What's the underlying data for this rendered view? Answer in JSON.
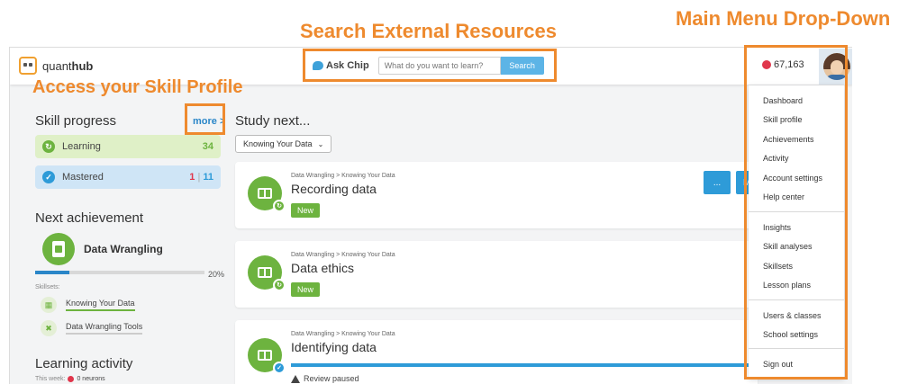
{
  "annotations": {
    "search_label": "Search External Resources",
    "menu_label": "Main Menu Drop-Down",
    "profile_label": "Access your Skill Profile"
  },
  "header": {
    "logo_prefix": "quant",
    "logo_bold": "hub",
    "ask_chip": "Ask Chip",
    "search_placeholder": "What do you want to learn?",
    "search_button": "Search",
    "neurons": "67,163"
  },
  "sidebar": {
    "skill_progress_title": "Skill progress",
    "more_link": "more >",
    "learning_label": "Learning",
    "learning_count": "34",
    "mastered_label": "Mastered",
    "mastered_count_a": "1",
    "mastered_sep": "|",
    "mastered_count_b": "11",
    "next_achievement_title": "Next achievement",
    "achievement_name": "Data Wrangling",
    "achievement_progress_pct": "20%",
    "achievement_progress_value": 0.2,
    "skillsets_label": "Skillsets:",
    "skillsets": [
      "Knowing Your Data",
      "Data Wrangling Tools"
    ],
    "learning_activity_title": "Learning activity",
    "this_week": "This week:",
    "this_week_value": "0 neurons"
  },
  "main": {
    "study_next_title": "Study next...",
    "filter_value": "Knowing Your Data",
    "cards": [
      {
        "crumb": "Data Wrangling > Knowing Your Data",
        "title": "Recording data",
        "tag": "New",
        "dots": "...",
        "button_partial": "M"
      },
      {
        "crumb": "Data Wrangling > Knowing Your Data",
        "title": "Data ethics",
        "tag": "New"
      },
      {
        "crumb": "Data Wrangling > Knowing Your Data",
        "title": "Identifying data",
        "status": "Review paused"
      }
    ]
  },
  "menu": {
    "group1": [
      "Dashboard",
      "Skill profile",
      "Achievements",
      "Activity",
      "Account settings",
      "Help center"
    ],
    "group2": [
      "Insights",
      "Skill analyses",
      "Skillsets",
      "Lesson plans"
    ],
    "group3": [
      "Users & classes",
      "School settings"
    ],
    "group4": [
      "Sign out"
    ]
  },
  "colors": {
    "annotation": "#ee8a2e",
    "accent_blue": "#2e9bd8",
    "accent_green": "#6db33f",
    "neuron_red": "#e0364b"
  }
}
